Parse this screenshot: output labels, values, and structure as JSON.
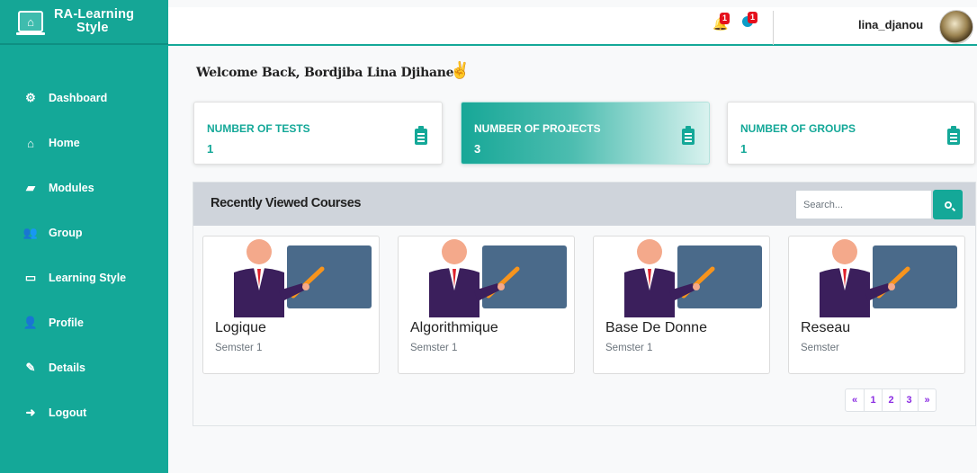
{
  "brand": {
    "line1": "RA-Learning",
    "line2": "Style"
  },
  "sidebar": {
    "items": [
      {
        "label": "Dashboard",
        "icon": "dashboard-icon",
        "glyph": "⚙"
      },
      {
        "label": "Home",
        "icon": "home-icon",
        "glyph": "⌂"
      },
      {
        "label": "Modules",
        "icon": "book-icon",
        "glyph": "▰"
      },
      {
        "label": "Group",
        "icon": "users-icon",
        "glyph": "👥"
      },
      {
        "label": "Learning Style",
        "icon": "laptop-icon",
        "glyph": "▭"
      },
      {
        "label": "Profile",
        "icon": "user-cog-icon",
        "glyph": "👤"
      },
      {
        "label": "Details",
        "icon": "edit-icon",
        "glyph": "✎"
      },
      {
        "label": "Logout",
        "icon": "sign-out-icon",
        "glyph": "➜"
      }
    ]
  },
  "topbar": {
    "notifications_count": "1",
    "messages_count": "1",
    "username": "lina_djanou"
  },
  "welcome": {
    "text": "Welcome Back, Bordjiba Lina Djihane",
    "emoji": "✌"
  },
  "stats": [
    {
      "label": "NUMBER OF TESTS",
      "value": "1"
    },
    {
      "label": "NUMBER OF PROJECTS",
      "value": "3"
    },
    {
      "label": "NUMBER OF GROUPS",
      "value": "1"
    }
  ],
  "courses": {
    "title": "Recently Viewed Courses",
    "search_placeholder": "Search...",
    "items": [
      {
        "title": "Logique",
        "subtitle": "Semster 1"
      },
      {
        "title": "Algorithmique",
        "subtitle": "Semster 1"
      },
      {
        "title": "Base De Donne",
        "subtitle": "Semster 1"
      },
      {
        "title": "Reseau",
        "subtitle": "Semster"
      }
    ],
    "pagination": [
      "«",
      "1",
      "2",
      "3",
      "»"
    ]
  },
  "colors": {
    "accent": "#14a898",
    "panel_header": "#cfd4db",
    "badge": "#e5101c",
    "pager_link": "#8a2be2"
  }
}
